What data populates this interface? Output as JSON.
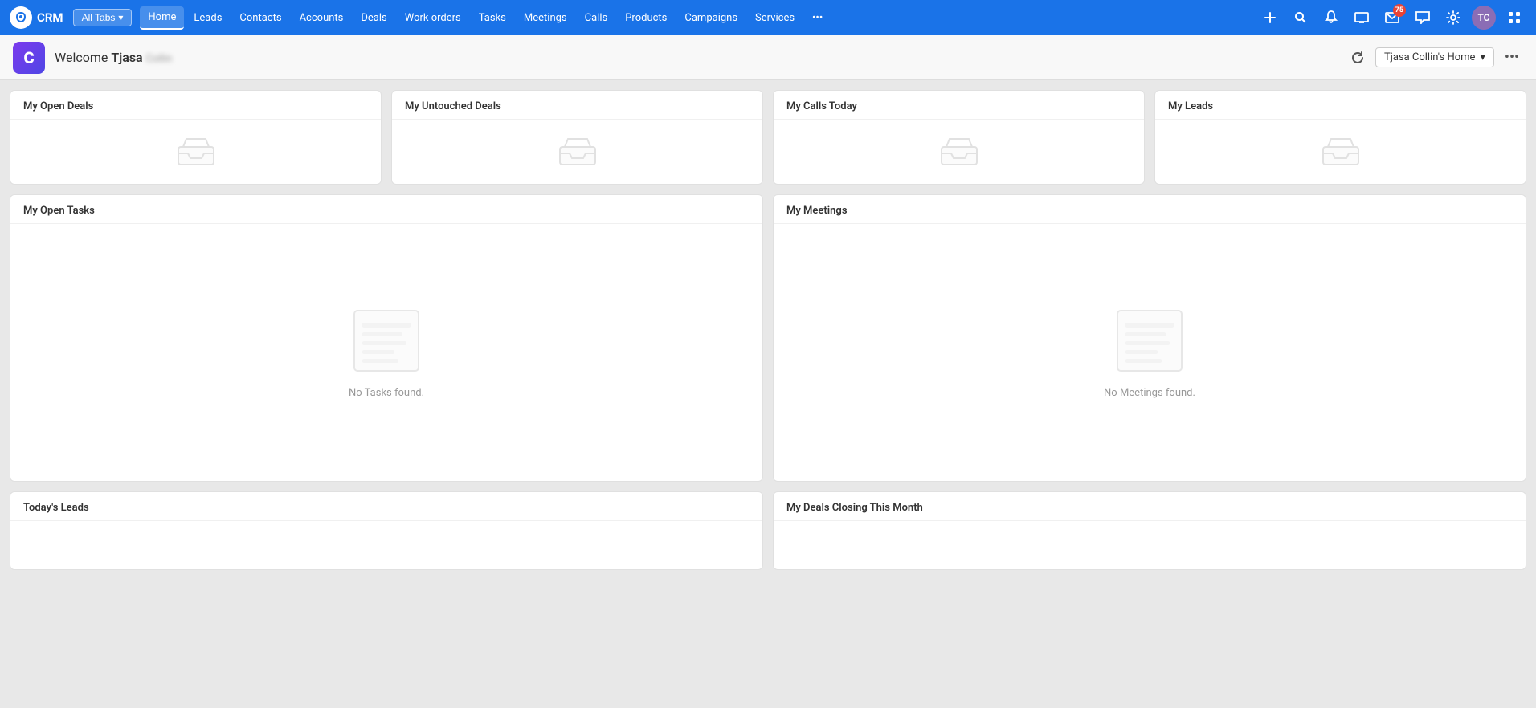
{
  "nav": {
    "logo_text": "CRM",
    "all_tabs_label": "All Tabs",
    "items": [
      {
        "label": "Home",
        "active": true
      },
      {
        "label": "Leads"
      },
      {
        "label": "Contacts"
      },
      {
        "label": "Accounts"
      },
      {
        "label": "Deals"
      },
      {
        "label": "Work orders"
      },
      {
        "label": "Tasks"
      },
      {
        "label": "Meetings"
      },
      {
        "label": "Calls"
      },
      {
        "label": "Products"
      },
      {
        "label": "Campaigns"
      },
      {
        "label": "Services"
      },
      {
        "label": "•••"
      }
    ],
    "email_badge": "75"
  },
  "header": {
    "welcome_prefix": "Welcome",
    "user_first_name": "Tjasa",
    "home_selector_label": "Tjasa Collin's Home"
  },
  "widgets": {
    "top_row": [
      {
        "id": "open-deals",
        "title": "My Open Deals"
      },
      {
        "id": "untouched-deals",
        "title": "My Untouched Deals"
      },
      {
        "id": "calls-today",
        "title": "My Calls Today"
      },
      {
        "id": "my-leads",
        "title": "My Leads"
      }
    ],
    "middle_row": [
      {
        "id": "open-tasks",
        "title": "My Open Tasks",
        "empty_text": "No Tasks found."
      },
      {
        "id": "meetings",
        "title": "My Meetings",
        "empty_text": "No Meetings found."
      }
    ],
    "bottom_row": [
      {
        "id": "todays-leads",
        "title": "Today's Leads"
      },
      {
        "id": "deals-closing",
        "title": "My Deals Closing This Month"
      }
    ]
  }
}
